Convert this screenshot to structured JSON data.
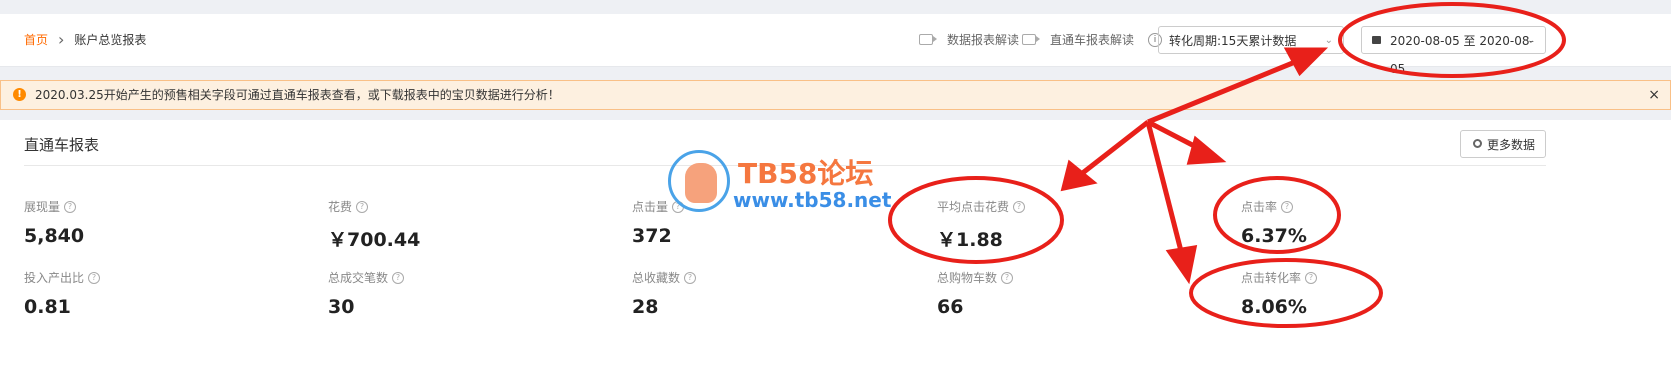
{
  "breadcrumb": {
    "home": "首页",
    "current": "账户总览报表"
  },
  "top_links": {
    "data_report": "数据报表解读",
    "train_report": "直通车报表解读"
  },
  "conversion_select": {
    "value": "转化周期:15天累计数据"
  },
  "date_range": {
    "value": "2020-08-05 至 2020-08-05"
  },
  "notice": {
    "text": "2020.03.25开始产生的预售相关字段可通过直通车报表查看，或下载报表中的宝贝数据进行分析！",
    "icon": "!",
    "close": "×"
  },
  "panel": {
    "title": "直通车报表",
    "more_button": "更多数据"
  },
  "metrics": [
    {
      "label": "展现量",
      "value": "5,840"
    },
    {
      "label": "花费",
      "value": "￥700.44"
    },
    {
      "label": "点击量",
      "value": "372"
    },
    {
      "label": "平均点击花费",
      "value": "￥1.88"
    },
    {
      "label": "点击率",
      "value": "6.37%"
    },
    {
      "label": "投入产出比",
      "value": "0.81"
    },
    {
      "label": "总成交笔数",
      "value": "30"
    },
    {
      "label": "总收藏数",
      "value": "28"
    },
    {
      "label": "总购物车数",
      "value": "66"
    },
    {
      "label": "点击转化率",
      "value": "8.06%"
    }
  ],
  "watermark": {
    "title": "TB58论坛",
    "url": "www.tb58.net"
  },
  "colors": {
    "accent": "#ff6a00",
    "annotation": "#e8201a",
    "notice_bg": "#fdf0e0"
  }
}
